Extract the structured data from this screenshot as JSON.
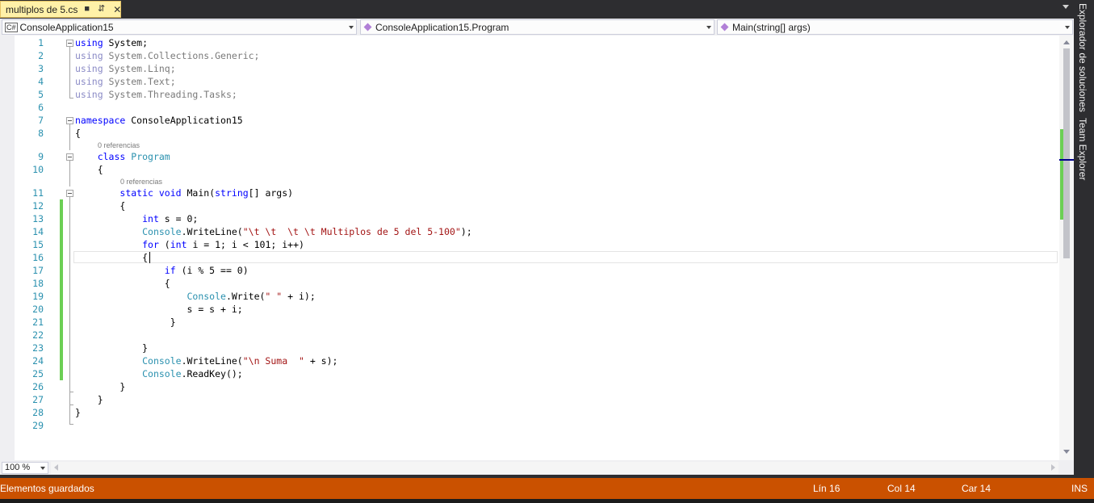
{
  "tab": {
    "label": "multiplos de 5.cs",
    "pin_icon": "pin-icon",
    "close_icon": "close-icon"
  },
  "navbar": {
    "project": "ConsoleApplication15",
    "project_icon_text": "C#",
    "class": "ConsoleApplication15.Program",
    "member": "Main(string[] args)"
  },
  "editor": {
    "line_numbers": [
      "1",
      "2",
      "3",
      "4",
      "5",
      "6",
      "7",
      "8",
      "9",
      "10",
      "11",
      "12",
      "13",
      "14",
      "15",
      "16",
      "17",
      "18",
      "19",
      "20",
      "21",
      "22",
      "23",
      "24",
      "25",
      "26",
      "27",
      "28",
      "29"
    ],
    "codelens_class": "0 referencias",
    "codelens_method": "0 referencias",
    "lines": {
      "l1": {
        "kw": "using",
        "rest": " System;"
      },
      "l2": {
        "kw": "using",
        "rest": " System.Collections.Generic;"
      },
      "l3": {
        "kw": "using",
        "rest": " System.Linq;"
      },
      "l4": {
        "kw": "using",
        "rest": " System.Text;"
      },
      "l5": {
        "kw": "using",
        "rest": " System.Threading.Tasks;"
      },
      "l7": {
        "kw": "namespace",
        "rest": " ConsoleApplication15"
      },
      "l8": {
        "text": "{"
      },
      "l9": {
        "indent": "    ",
        "kw": "class",
        "sp": " ",
        "type": "Program"
      },
      "l10": {
        "text": "    {"
      },
      "l11": {
        "indent": "        ",
        "kw1": "static",
        "sp1": " ",
        "kw2": "void",
        "mid": " Main(",
        "kw3": "string",
        "rest": "[] args)"
      },
      "l12": {
        "text": "        {"
      },
      "l13": {
        "indent": "            ",
        "kw": "int",
        "rest": " s = 0;"
      },
      "l14": {
        "indent": "            ",
        "type": "Console",
        "mid": ".WriteLine(",
        "str": "\"\\t \\t  \\t \\t Multiplos de 5 del 5-100\"",
        "rest": ");"
      },
      "l15": {
        "indent": "            ",
        "kw1": "for",
        "mid1": " (",
        "kw2": "int",
        "rest": " i = 1; i < 101; i++)"
      },
      "l16": {
        "text": "            {"
      },
      "l17": {
        "indent": "                ",
        "kw": "if",
        "rest": " (i % 5 == 0)"
      },
      "l18": {
        "text": "                {"
      },
      "l19": {
        "indent": "                    ",
        "type": "Console",
        "mid": ".Write(",
        "str": "\" \"",
        "rest": " + i);"
      },
      "l20": {
        "text": "                    s = s + i;"
      },
      "l21": {
        "text": "                 }"
      },
      "l23": {
        "text": "            }"
      },
      "l24": {
        "indent": "            ",
        "type": "Console",
        "mid": ".WriteLine(",
        "str": "\"\\n Suma  \"",
        "rest": " + s);"
      },
      "l25": {
        "indent": "            ",
        "type": "Console",
        "rest": ".ReadKey();"
      },
      "l26": {
        "text": "        }"
      },
      "l27": {
        "text": "    }"
      },
      "l28": {
        "text": "}"
      }
    }
  },
  "zoom": "100 %",
  "side_tabs": {
    "solution_explorer": "Explorador de soluciones",
    "team_explorer": "Team Explorer"
  },
  "status": {
    "message": "Elementos guardados",
    "line": "Lín 16",
    "col": "Col 14",
    "char": "Car 14",
    "mode": "INS"
  },
  "colors": {
    "status_bar": "#ca5100",
    "tab_active": "#fff1a8",
    "keyword": "#0000ff",
    "type": "#2b91af",
    "string": "#a31515",
    "line_number": "#2b91af",
    "change_marker": "#6ccf55"
  }
}
